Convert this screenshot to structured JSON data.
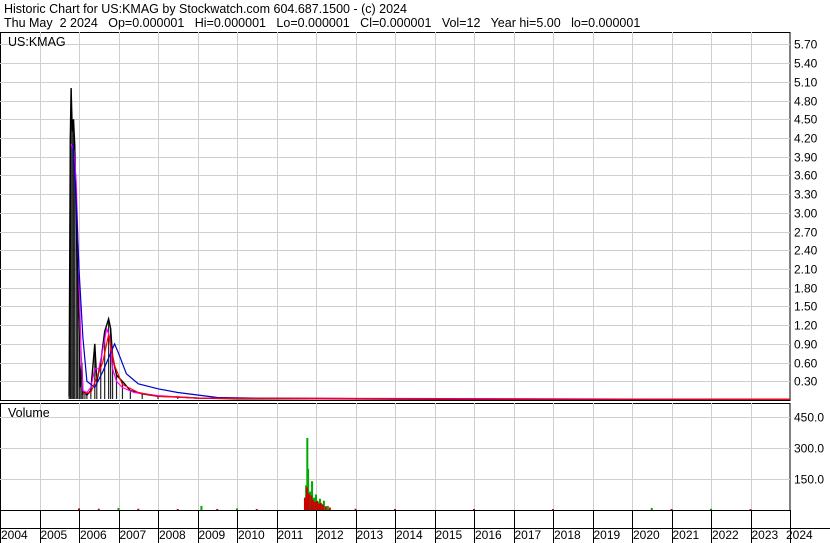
{
  "header": {
    "line1": "Historic Chart for US:KMAG by Stockwatch.com 604.687.1500 - (c) 2024",
    "line2": "Thu May  2 2024   Op=0.000001   Hi=0.000001   Lo=0.000001   Cl=0.000001   Vol=12   Year hi=5.00   lo=0.000001"
  },
  "chart_data": [
    {
      "type": "line",
      "title": "US:KMAG",
      "ylim": [
        0,
        5.9
      ],
      "yticks": [
        "5.70",
        "5.40",
        "5.10",
        "4.80",
        "4.50",
        "4.20",
        "3.90",
        "3.60",
        "3.30",
        "3.00",
        "2.70",
        "2.40",
        "2.10",
        "1.80",
        "1.50",
        "1.20",
        "0.90",
        "0.60",
        "0.30"
      ],
      "ytick_values": [
        5.7,
        5.4,
        5.1,
        4.8,
        4.5,
        4.2,
        3.9,
        3.6,
        3.3,
        3.0,
        2.7,
        2.4,
        2.1,
        1.8,
        1.5,
        1.2,
        0.9,
        0.6,
        0.3
      ],
      "xlim": [
        2004.0,
        2024.0
      ],
      "x_tick_labels": [
        "2004",
        "2005",
        "2006",
        "2007",
        "2008",
        "2009",
        "2010",
        "2011",
        "2012",
        "2013",
        "2014",
        "2015",
        "2016",
        "2017",
        "2018",
        "2019",
        "2020",
        "2021",
        "2022",
        "2023",
        "2024"
      ],
      "grid": true,
      "series": [
        {
          "color": "#000000",
          "style": "price bars",
          "points": [
            [
              2005.75,
              0.05
            ],
            [
              2005.78,
              4.2
            ],
            [
              2005.8,
              5.0
            ],
            [
              2005.83,
              4.3
            ],
            [
              2005.86,
              4.5
            ],
            [
              2005.89,
              4.1
            ],
            [
              2005.93,
              3.0
            ],
            [
              2005.96,
              2.2
            ],
            [
              2006.0,
              1.2
            ],
            [
              2006.03,
              0.2
            ],
            [
              2006.07,
              0.6
            ],
            [
              2006.1,
              0.1
            ],
            [
              2006.15,
              0.12
            ],
            [
              2006.2,
              0.08
            ],
            [
              2006.3,
              0.15
            ],
            [
              2006.4,
              0.9
            ],
            [
              2006.45,
              0.3
            ],
            [
              2006.55,
              0.6
            ],
            [
              2006.65,
              1.1
            ],
            [
              2006.75,
              1.3
            ],
            [
              2006.8,
              1.15
            ],
            [
              2006.85,
              0.7
            ],
            [
              2006.95,
              0.4
            ],
            [
              2007.1,
              0.3
            ],
            [
              2007.3,
              0.15
            ],
            [
              2007.6,
              0.1
            ],
            [
              2008.0,
              0.06
            ],
            [
              2008.5,
              0.05
            ],
            [
              2009.0,
              0.03
            ],
            [
              2010.0,
              0.02
            ],
            [
              2012.0,
              0.02
            ],
            [
              2016.0,
              0.01
            ],
            [
              2020.0,
              0.01
            ],
            [
              2024.0,
              0.01
            ]
          ]
        },
        {
          "color": "#ff00ff",
          "style": "line",
          "points": [
            [
              2005.8,
              4.1
            ],
            [
              2005.87,
              4.0
            ],
            [
              2005.93,
              3.5
            ],
            [
              2006.0,
              2.0
            ],
            [
              2006.05,
              0.8
            ],
            [
              2006.1,
              0.15
            ],
            [
              2006.2,
              0.12
            ],
            [
              2006.3,
              0.2
            ],
            [
              2006.4,
              0.5
            ],
            [
              2006.5,
              0.5
            ],
            [
              2006.6,
              0.8
            ],
            [
              2006.7,
              1.15
            ],
            [
              2006.78,
              1.0
            ],
            [
              2006.85,
              0.5
            ],
            [
              2006.95,
              0.3
            ],
            [
              2007.1,
              0.2
            ],
            [
              2007.4,
              0.12
            ],
            [
              2008.0,
              0.07
            ],
            [
              2009.0,
              0.03
            ],
            [
              2012.0,
              0.02
            ],
            [
              2016.0,
              0.01
            ],
            [
              2024.0,
              0.01
            ]
          ]
        },
        {
          "color": "#0000cc",
          "style": "line",
          "points": [
            [
              2005.85,
              4.1
            ],
            [
              2005.93,
              3.2
            ],
            [
              2006.0,
              2.1
            ],
            [
              2006.1,
              1.0
            ],
            [
              2006.2,
              0.3
            ],
            [
              2006.4,
              0.2
            ],
            [
              2006.6,
              0.45
            ],
            [
              2006.8,
              0.75
            ],
            [
              2006.9,
              0.9
            ],
            [
              2007.0,
              0.75
            ],
            [
              2007.2,
              0.42
            ],
            [
              2007.5,
              0.26
            ],
            [
              2008.0,
              0.18
            ],
            [
              2008.5,
              0.12
            ],
            [
              2009.0,
              0.08
            ],
            [
              2009.5,
              0.04
            ],
            [
              2010.5,
              0.03
            ],
            [
              2012.0,
              0.025
            ],
            [
              2016.0,
              0.015
            ],
            [
              2024.0,
              0.01
            ]
          ]
        },
        {
          "color": "#ff0000",
          "style": "line",
          "points": [
            [
              2006.1,
              0.1
            ],
            [
              2006.3,
              0.12
            ],
            [
              2006.6,
              0.6
            ],
            [
              2006.75,
              1.05
            ],
            [
              2006.9,
              0.55
            ],
            [
              2007.1,
              0.25
            ],
            [
              2007.5,
              0.12
            ],
            [
              2008.0,
              0.06
            ],
            [
              2009.0,
              0.03
            ],
            [
              2024.0,
              0.01
            ]
          ]
        }
      ]
    },
    {
      "type": "bar",
      "title": "Volume",
      "ylim": [
        0,
        520
      ],
      "yticks": [
        "450.0",
        "300.0",
        "150.0"
      ],
      "ytick_values": [
        450,
        300,
        150
      ],
      "xlim": [
        2004.0,
        2024.0
      ],
      "series": [
        {
          "name": "",
          "color": "#00aa00",
          "points": [
            [
              2011.75,
              120
            ],
            [
              2011.78,
              350
            ],
            [
              2011.8,
              200
            ],
            [
              2011.85,
              90
            ],
            [
              2011.9,
              140
            ],
            [
              2011.95,
              60
            ],
            [
              2012.0,
              75
            ],
            [
              2012.05,
              40
            ],
            [
              2012.1,
              55
            ],
            [
              2012.15,
              30
            ],
            [
              2012.2,
              45
            ],
            [
              2012.3,
              20
            ],
            [
              2007.0,
              10
            ],
            [
              2009.1,
              20
            ],
            [
              2010.0,
              8
            ],
            [
              2020.5,
              10
            ],
            [
              2022.0,
              6
            ]
          ]
        },
        {
          "name": "",
          "color": "#cc0000",
          "points": [
            [
              2011.72,
              60
            ],
            [
              2011.77,
              110
            ],
            [
              2011.82,
              80
            ],
            [
              2011.88,
              70
            ],
            [
              2011.92,
              50
            ],
            [
              2011.98,
              40
            ],
            [
              2012.03,
              45
            ],
            [
              2012.08,
              30
            ],
            [
              2012.12,
              35
            ],
            [
              2012.18,
              25
            ],
            [
              2012.25,
              18
            ],
            [
              2012.35,
              12
            ],
            [
              2006.0,
              8
            ],
            [
              2006.5,
              6
            ],
            [
              2007.5,
              6
            ],
            [
              2008.5,
              5
            ],
            [
              2009.5,
              5
            ],
            [
              2010.5,
              5
            ],
            [
              2013.0,
              6
            ],
            [
              2014.0,
              5
            ],
            [
              2016.0,
              5
            ],
            [
              2018.0,
              4
            ],
            [
              2021.0,
              5
            ],
            [
              2023.0,
              4
            ]
          ]
        }
      ]
    }
  ]
}
